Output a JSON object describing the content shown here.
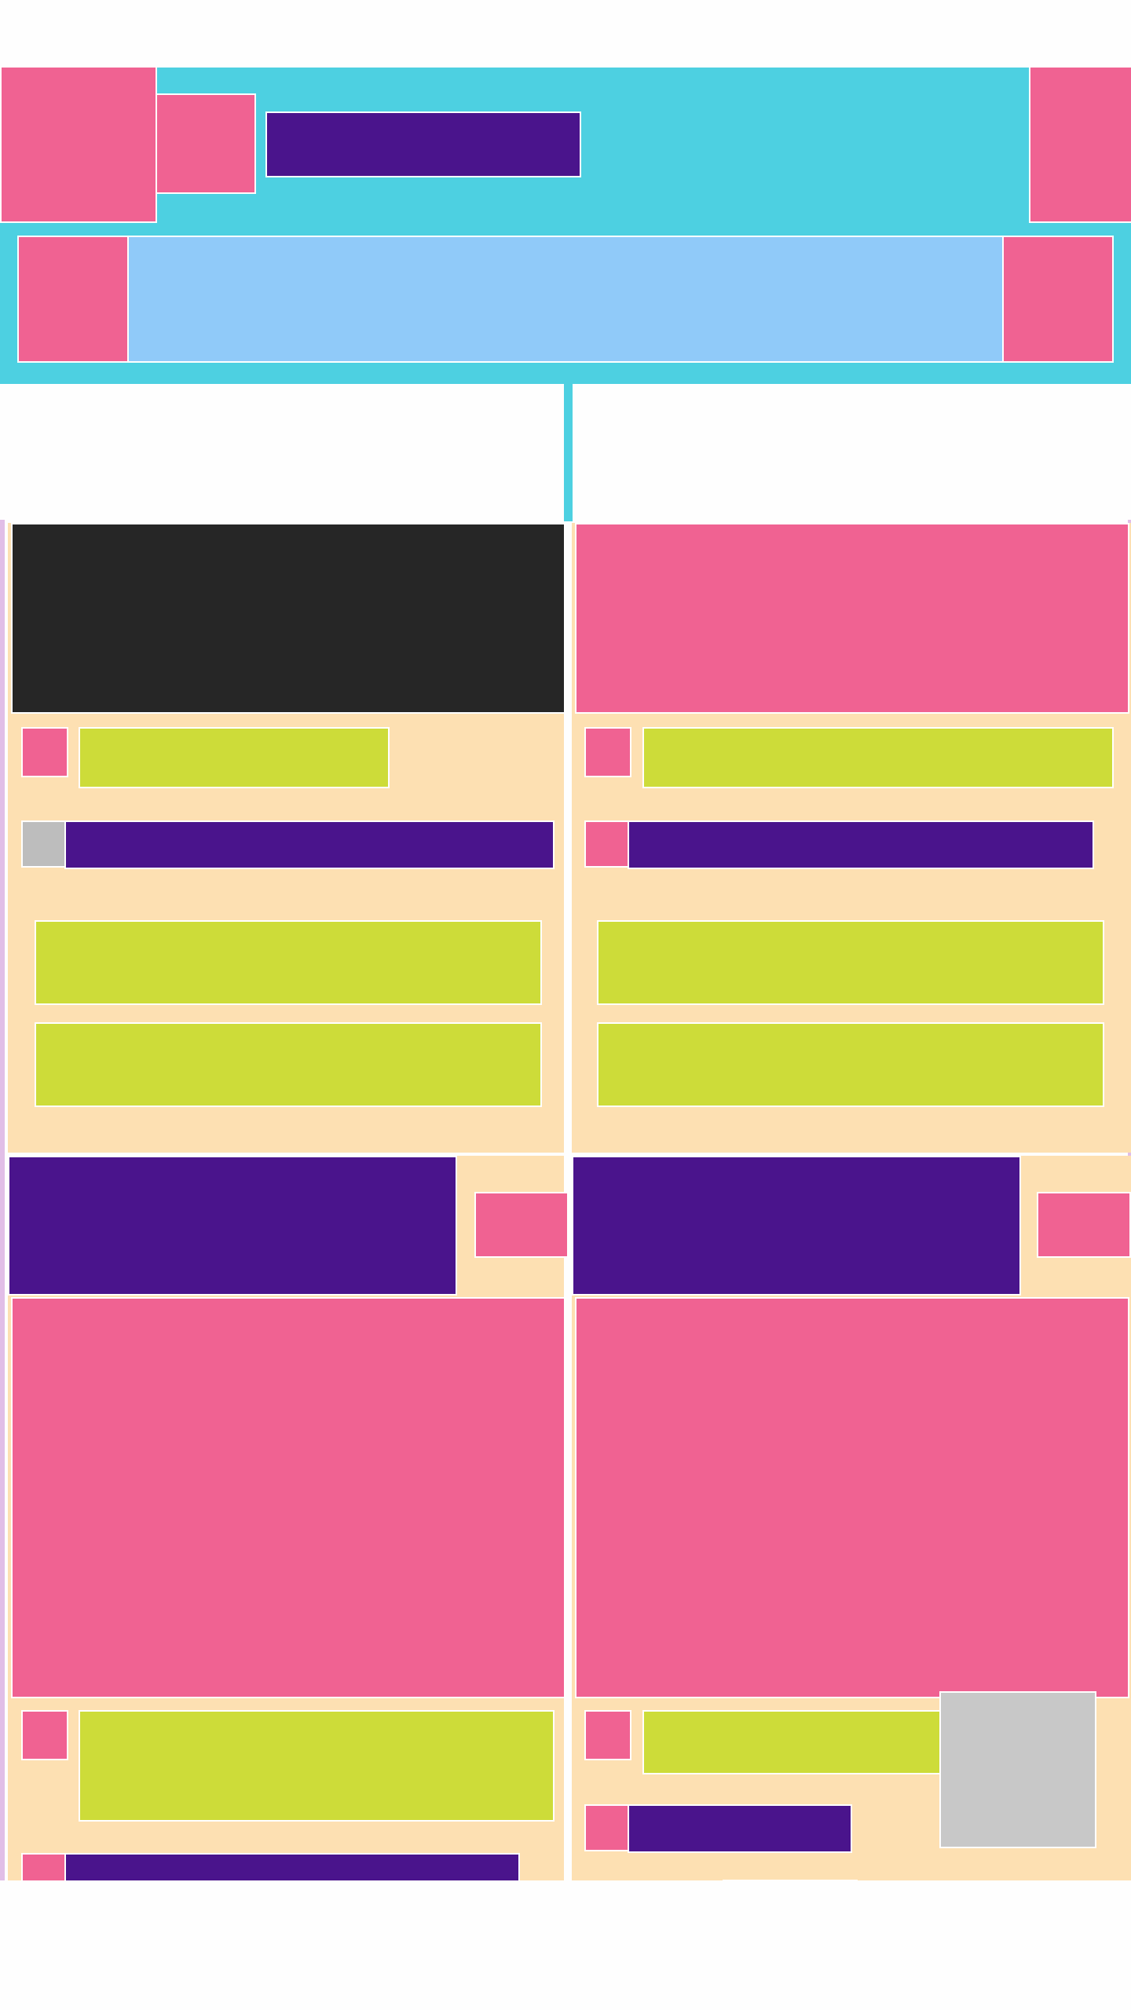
{
  "colors": {
    "header_cyan": "#4dd0e1",
    "accent_pink": "#f06292",
    "primary_purple": "#4a148c",
    "search_blue": "#90caf9",
    "card_cream": "#fde0b2",
    "placeholder_lime": "#cddc39",
    "media_dark": "#262626",
    "avatar_gray": "#bdbdbd",
    "overlay_gray": "#c8c8c8",
    "divider_lavender": "#e1bee7",
    "page_white": "#fefefe"
  },
  "header": {
    "left_action_icon": "menu-icon",
    "logo_icon": "logo-icon",
    "title": "",
    "right_action_icon": "more-icon"
  },
  "search": {
    "leading_icon": "search-icon",
    "placeholder": "",
    "trailing_icon": "filter-icon"
  },
  "cards": [
    {
      "media": "image",
      "author_icon": "avatar-icon",
      "author_name": "",
      "meta_icon": "avatar-placeholder-icon",
      "meta_text": "",
      "lines": [
        "",
        ""
      ]
    },
    {
      "media": "image",
      "author_icon": "avatar-icon",
      "author_name": "",
      "meta_icon": "tag-icon",
      "meta_text": "",
      "lines": [
        "",
        ""
      ]
    },
    {
      "media": "image",
      "banner_text": "",
      "banner_action_icon": "action-icon",
      "author_icon": "avatar-icon",
      "author_name": "",
      "meta_icon": "tag-icon",
      "meta_text": ""
    },
    {
      "media": "image",
      "banner_text": "",
      "banner_action_icon": "action-icon",
      "author_icon": "avatar-icon",
      "author_name": "",
      "meta_icon": "tag-icon",
      "meta_text": "",
      "footer_text": "",
      "overlay": "thumbnail-placeholder"
    }
  ]
}
